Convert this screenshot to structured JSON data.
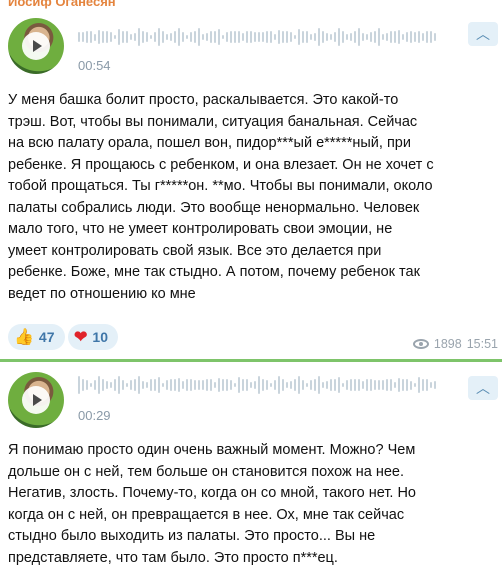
{
  "messages": [
    {
      "sender": "Иосиф Оганесян",
      "duration": "00:54",
      "text": "У меня башка болит просто, раскалывается. Это какой-то\nтрэш. Вот, чтобы вы понимали, ситуация банальная. Сейчас\nна всю палату орала, пошел вон, пидор***ый е*****ный, при\nребенке. Я прощаюсь с ребенком, и она влезает. Он не хочет с\nтобой прощаться. Ты г*****он. **мо. Чтобы вы понимали, около\nпалаты собрались люди. Это вообще ненормально. Человек\nмало того, что не умеет контролировать свои эмоции, не\nумеет контролировать свой язык. Все это делается при\nребенке. Боже, мне так стыдно. А потом, почему ребенок так\nведет по отношению ко мне",
      "reactions": [
        {
          "icon": "thumbs-up",
          "emoji": "👍",
          "count": "47"
        },
        {
          "icon": "red-heart",
          "emoji": "❤",
          "count": "10"
        }
      ],
      "views": "1898",
      "time": "15:51"
    },
    {
      "duration": "00:29",
      "text": "Я понимаю просто один очень важный момент. Можно? Чем\nдольше он с ней, тем больше он становится похож на нее.\nНегатив, злость. Почему-то, когда он со мной, такого нет. Но\nкогда он с ней, он превращается в нее. Ох, мне так сейчас\nстыдно было выходить из палаты. Это просто... Вы не\nпредставляете, что там было. Это просто п***ец."
    }
  ],
  "icons": {
    "collapse": "chevron-up-icon",
    "views": "eye-icon",
    "play": "play-icon"
  },
  "colors": {
    "sender": "#e4843e",
    "reaction_bg": "#e4f0f8",
    "separator": "#7ec46a",
    "meta": "#9aa4ad"
  }
}
